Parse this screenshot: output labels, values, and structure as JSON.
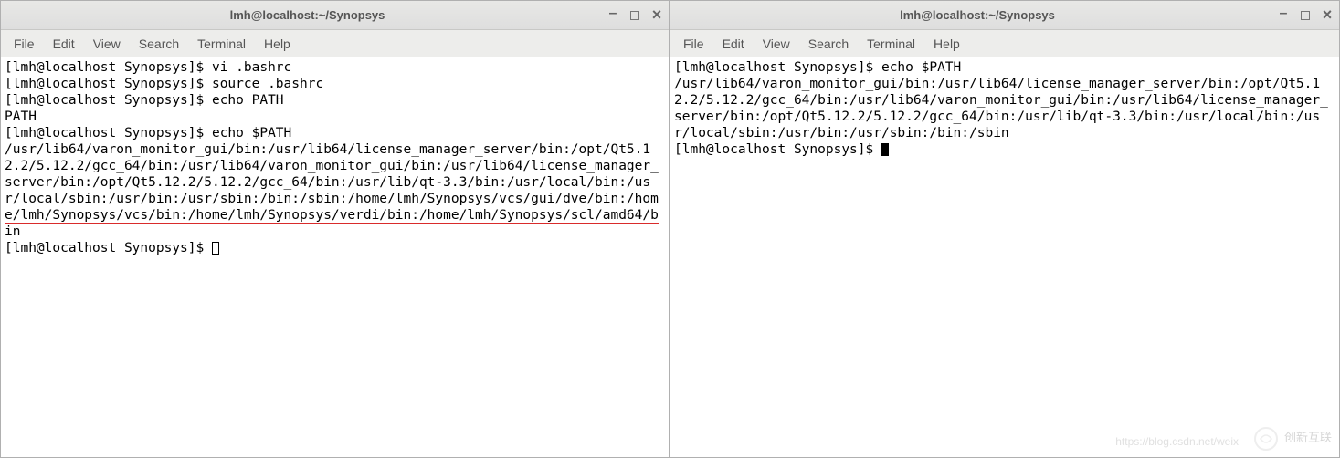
{
  "menus": [
    "File",
    "Edit",
    "View",
    "Search",
    "Terminal",
    "Help"
  ],
  "window_left": {
    "title": "lmh@localhost:~/Synopsys",
    "lines": [
      "[lmh@localhost Synopsys]$ vi .bashrc",
      "[lmh@localhost Synopsys]$ source .bashrc",
      "[lmh@localhost Synopsys]$ echo PATH",
      "PATH",
      "[lmh@localhost Synopsys]$ echo $PATH",
      "/usr/lib64/varon_monitor_gui/bin:/usr/lib64/license_manager_server/bin:/opt/Qt5.12.2/5.12.2/gcc_64/bin:/usr/lib64/varon_monitor_gui/bin:/usr/lib64/license_manager_server/bin:/opt/Qt5.12.2/5.12.2/gcc_64/bin:/usr/lib/qt-3.3/bin:/usr/local/bin:/usr/local/sbin:/usr/bin:/usr/sbin:/bin:/sbin:/home/lmh/Synopsys/vcs/gui/dve/bin:/home/lmh/Synopsys/vcs/bin:/home/lmh/Synopsys/verdi/bin:/home/lmh/Synopsys/scl/amd64/bin"
    ],
    "prompt": "[lmh@localhost Synopsys]$ "
  },
  "window_right": {
    "title": "lmh@localhost:~/Synopsys",
    "lines": [
      "[lmh@localhost Synopsys]$ echo $PATH",
      "/usr/lib64/varon_monitor_gui/bin:/usr/lib64/license_manager_server/bin:/opt/Qt5.12.2/5.12.2/gcc_64/bin:/usr/lib64/varon_monitor_gui/bin:/usr/lib64/license_manager_server/bin:/opt/Qt5.12.2/5.12.2/gcc_64/bin:/usr/lib/qt-3.3/bin:/usr/local/bin:/usr/local/sbin:/usr/bin:/usr/sbin:/bin:/sbin"
    ],
    "prompt": "[lmh@localhost Synopsys]$ "
  },
  "watermark": {
    "brand": "创新互联",
    "url": "https://blog.csdn.net/weix"
  }
}
